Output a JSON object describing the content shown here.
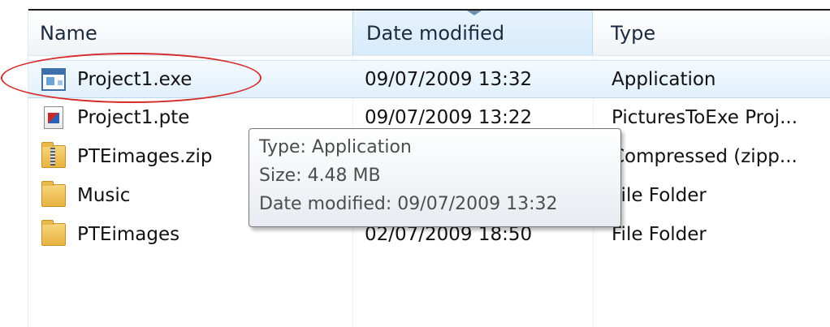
{
  "columns": {
    "name": "Name",
    "date_modified": "Date modified",
    "type": "Type"
  },
  "files": [
    {
      "name": "Project1.exe",
      "date": "09/07/2009 13:32",
      "type": "Application",
      "icon": "exe-application-icon",
      "selected": true
    },
    {
      "name": "Project1.pte",
      "date": "09/07/2009 13:22",
      "type": "PicturesToExe Proj...",
      "icon": "pte-file-icon",
      "selected": false
    },
    {
      "name": "PTEimages.zip",
      "date": "",
      "type": "Compressed (zipp...",
      "icon": "zip-folder-icon",
      "selected": false
    },
    {
      "name": "Music",
      "date": "",
      "type": "File Folder",
      "icon": "folder-icon",
      "selected": false
    },
    {
      "name": "PTEimages",
      "date": "02/07/2009 18:50",
      "type": "File Folder",
      "icon": "folder-icon",
      "selected": false
    }
  ],
  "tooltip": {
    "type_line": "Type: Application",
    "size_line": "Size: 4.48 MB",
    "date_line": "Date modified: 09/07/2009 13:32"
  },
  "colors": {
    "annotation": "#d42a2a",
    "selection": "#e1f0fb"
  }
}
